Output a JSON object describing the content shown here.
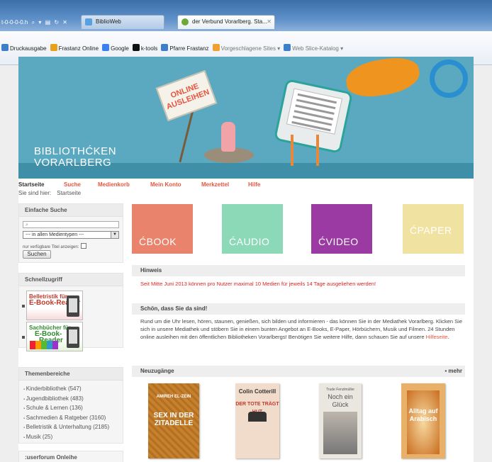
{
  "browser": {
    "address": "t-0-0-0-0.h",
    "tabs": [
      {
        "label": "BiblioWeb"
      },
      {
        "label": "der Verbund Vorarlberg. Sta..."
      }
    ],
    "favorites": [
      {
        "label": "Druckausgabe",
        "icon": "page-icon",
        "color": "#3d7fc9"
      },
      {
        "label": "Frastanz Online",
        "icon": "star-icon",
        "color": "#e6a21b"
      },
      {
        "label": "Google",
        "icon": "google-icon",
        "color": "#3b7ff0"
      },
      {
        "label": "k-tools",
        "icon": "k-tools-icon",
        "color": "#111111"
      },
      {
        "label": "Pfarre Frastanz",
        "icon": "page-icon",
        "color": "#3d7fc9"
      },
      {
        "label": "Vorgeschlagene Sites ▾",
        "icon": "suggested-icon",
        "color": "#f0a030",
        "dim": true
      },
      {
        "label": "Web Slice-Katalog ▾",
        "icon": "page-icon",
        "color": "#3d7fc9",
        "dim": true
      }
    ]
  },
  "banner": {
    "brand_line1": "BIBLIOTHĆKEN",
    "brand_line2": "VORARLBERG",
    "sign_line1": "ONLINE",
    "sign_line2": "AUSLEIHEN"
  },
  "nav": {
    "items": [
      "Startseite",
      "Suche",
      "Medienkorb",
      "Mein Konto",
      "Merkzettel",
      "Hilfe"
    ],
    "breadcrumb_label": "Sie sind hier:",
    "breadcrumb_value": "Startseite"
  },
  "search": {
    "title": "Einfache Suche",
    "input_value": "",
    "select_value": "--- in allen Medientypen ---",
    "checkbox_label": "nur verfügbare Titel anzeigen:",
    "button": "Suchen"
  },
  "quick": {
    "title": "Schnellzugriff",
    "items": [
      {
        "line1": "Belletristik für",
        "line2": "E-Book-Reader"
      },
      {
        "line1": "Sachbücher für",
        "line2": "E-Book-",
        "line3": "Reader"
      }
    ]
  },
  "themes": {
    "title": "Themenbereiche",
    "items": [
      "Kinderbibliothek (547)",
      "Jugendbibliothek (483)",
      "Schule & Lernen (136)",
      "Sachmedien & Ratgeber (3160)",
      "Belletristik & Unterhaltung (2185)",
      "Musik (25)"
    ]
  },
  "userforum": {
    "title": ":userforum Onleihe"
  },
  "tiles": [
    {
      "label": "ĆBOOK",
      "color": "#e9836c"
    },
    {
      "label": "ĆAUDIO",
      "color": "#8cd9b8"
    },
    {
      "label": "ĆVIDEO",
      "color": "#9b3aa3"
    },
    {
      "label": "ĆPAPER",
      "color": "#f0e2a0"
    }
  ],
  "hinweis": {
    "title": "Hinweis",
    "text": "Seit Mitte Juni 2013 können pro Nutzer maximal 10 Medien für jeweils 14 Tage ausgeliehen werden!"
  },
  "welcome": {
    "title": "Schön, dass Sie da sind!",
    "text": "Rund um die Uhr lesen, hören, staunen, genießen, sich bilden und informieren - das können Sie in der Mediathek Vorarlberg. Klicken Sie sich in unsere Mediathek und stöbern Sie in einem bunten Angebot an E-Books, E-Paper, Hörbüchern, Musik und Filmen. 24 Stunden online ausleihen mit den öffentlichen Bibliotheken Vorarlbergs! Benötigen Sie weitere Hilfe, dann schauen Sie auf unsere",
    "link": "Hilfeseite",
    "end": "."
  },
  "new": {
    "title": "Neuzugänge",
    "more": "▪ mehr",
    "books": [
      {
        "title": "SEX IN DER ZITADELLE",
        "author": "AMIREH EL-ZEIN"
      },
      {
        "title": "DER TOTE TRÄGT HUT",
        "author": "Colin Cotterill"
      },
      {
        "title": "Noch ein Glück",
        "author": "Trude Fenzlmüller"
      },
      {
        "title": "Alltag auf Arabisch",
        "author": ""
      }
    ]
  }
}
